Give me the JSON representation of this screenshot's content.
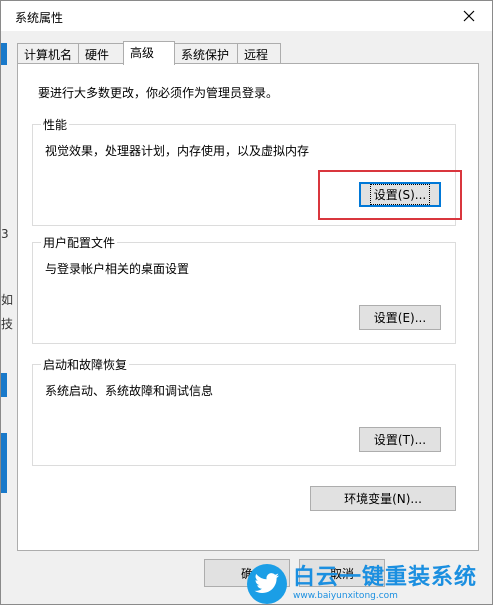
{
  "window": {
    "title": "系统属性",
    "close_glyph": "✕"
  },
  "background": {
    "fragments": [
      "3",
      "如",
      "技"
    ]
  },
  "tabs": [
    {
      "label": "计算机名",
      "active": false
    },
    {
      "label": "硬件",
      "active": false
    },
    {
      "label": "高级",
      "active": true
    },
    {
      "label": "系统保护",
      "active": false
    },
    {
      "label": "远程",
      "active": false
    }
  ],
  "advanced": {
    "admin_note": "要进行大多数更改，你必须作为管理员登录。",
    "performance": {
      "label": "性能",
      "description": "视觉效果，处理器计划，内存使用，以及虚拟内存",
      "button": "设置(S)..."
    },
    "user_profiles": {
      "label": "用户配置文件",
      "description": "与登录帐户相关的桌面设置",
      "button": "设置(E)..."
    },
    "startup_recovery": {
      "label": "启动和故障恢复",
      "description": "系统启动、系统故障和调试信息",
      "button": "设置(T)..."
    },
    "env_button": "环境变量(N)..."
  },
  "footer": {
    "ok_label": "确",
    "cancel_label": "取消"
  },
  "watermark": {
    "title": "白云一键重装系统",
    "url": "www.baiyunxitong.com"
  },
  "colors": {
    "highlight": "#d9363e",
    "focus": "#0078d7",
    "brand": "#1b9ee6"
  }
}
